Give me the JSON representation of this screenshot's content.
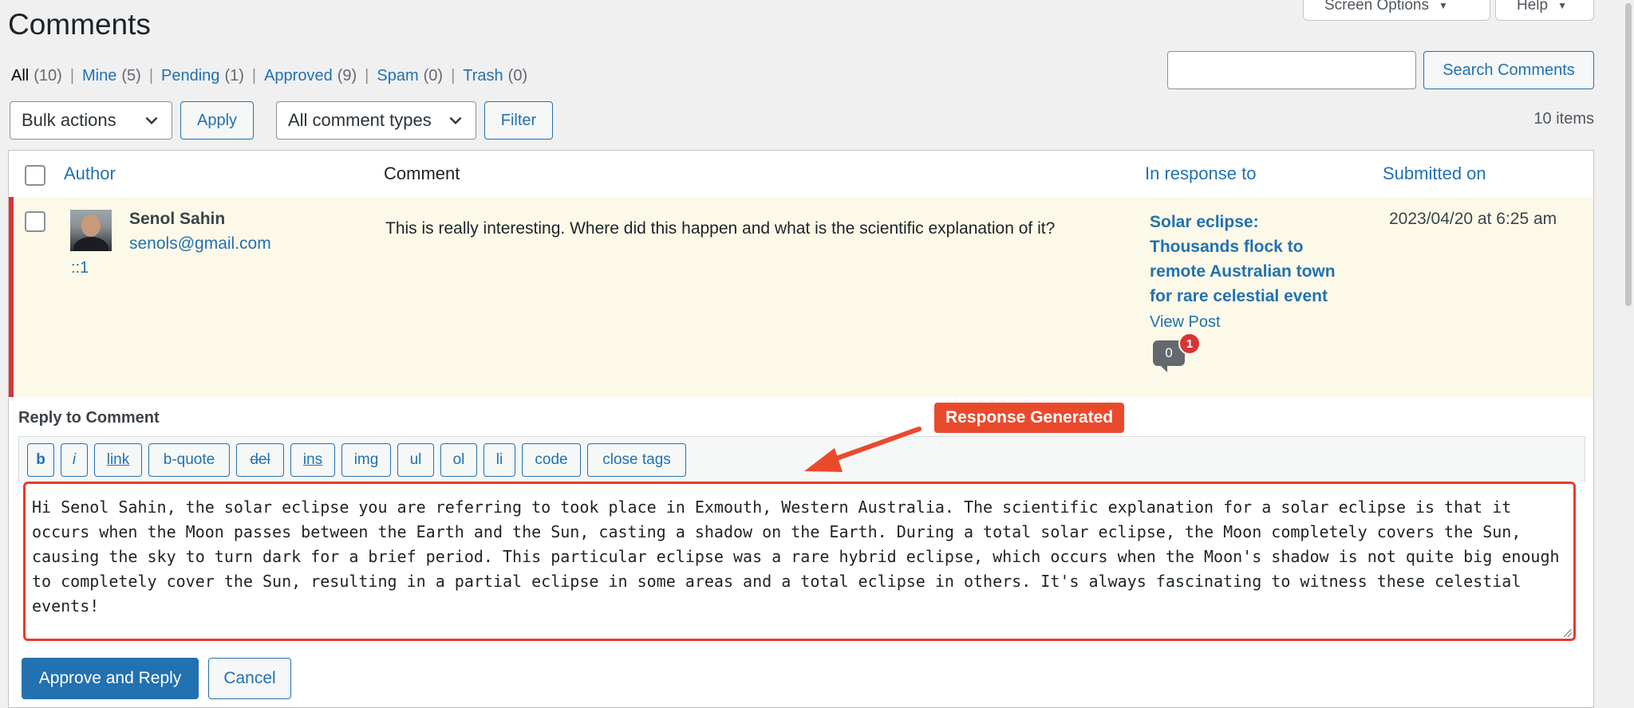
{
  "header": {
    "screen_options_label": "Screen Options",
    "help_label": "Help",
    "title": "Comments"
  },
  "filters": {
    "all": {
      "label": "All",
      "count": "(10)"
    },
    "mine": {
      "label": "Mine",
      "count": "(5)"
    },
    "pending": {
      "label": "Pending",
      "count": "(1)"
    },
    "approved": {
      "label": "Approved",
      "count": "(9)"
    },
    "spam": {
      "label": "Spam",
      "count": "(0)"
    },
    "trash": {
      "label": "Trash",
      "count": "(0)"
    },
    "separator": "|"
  },
  "search": {
    "placeholder": "",
    "button_label": "Search Comments"
  },
  "tablenav": {
    "bulk_actions": "Bulk actions",
    "apply_label": "Apply",
    "comment_types": "All comment types",
    "filter_label": "Filter",
    "items_count": "10 items"
  },
  "table": {
    "columns": {
      "author": "Author",
      "comment": "Comment",
      "in_response_to": "In response to",
      "submitted_on": "Submitted on"
    },
    "row": {
      "author_name": "Senol Sahin",
      "author_email": "senols@gmail.com",
      "author_ip": "::1",
      "comment": "This is really interesting. Where did this happen and what is the scientific explanation of it?",
      "post_title": "Solar eclipse: Thousands flock to remote Australian town for rare celestial event",
      "view_post": "View Post",
      "approved_count": "0",
      "pending_count": "1",
      "submitted": "2023/04/20 at 6:25 am"
    }
  },
  "reply": {
    "heading": "Reply to Comment",
    "quicktags": [
      "b",
      "i",
      "link",
      "b-quote",
      "del",
      "ins",
      "img",
      "ul",
      "ol",
      "li",
      "code",
      "close tags"
    ],
    "text": "Hi Senol Sahin, the solar eclipse you are referring to took place in Exmouth, Western Australia. The scientific explanation for a solar eclipse is that it occurs when the Moon passes between the Earth and the Sun, casting a shadow on the Earth. During a total solar eclipse, the Moon completely covers the Sun, causing the sky to turn dark for a brief period. This particular eclipse was a rare hybrid eclipse, which occurs when the Moon's shadow is not quite big enough to completely cover the Sun, resulting in a partial eclipse in some areas and a total eclipse in others. It's always fascinating to witness these celestial events!",
    "approve_reply_label": "Approve and Reply",
    "cancel_label": "Cancel"
  },
  "annotation": {
    "label": "Response Generated"
  },
  "colors": {
    "accent": "#2271b1",
    "pending_border": "#d63638",
    "pending_bg": "#fcf9e8",
    "annotation": "#ea4a2c"
  }
}
